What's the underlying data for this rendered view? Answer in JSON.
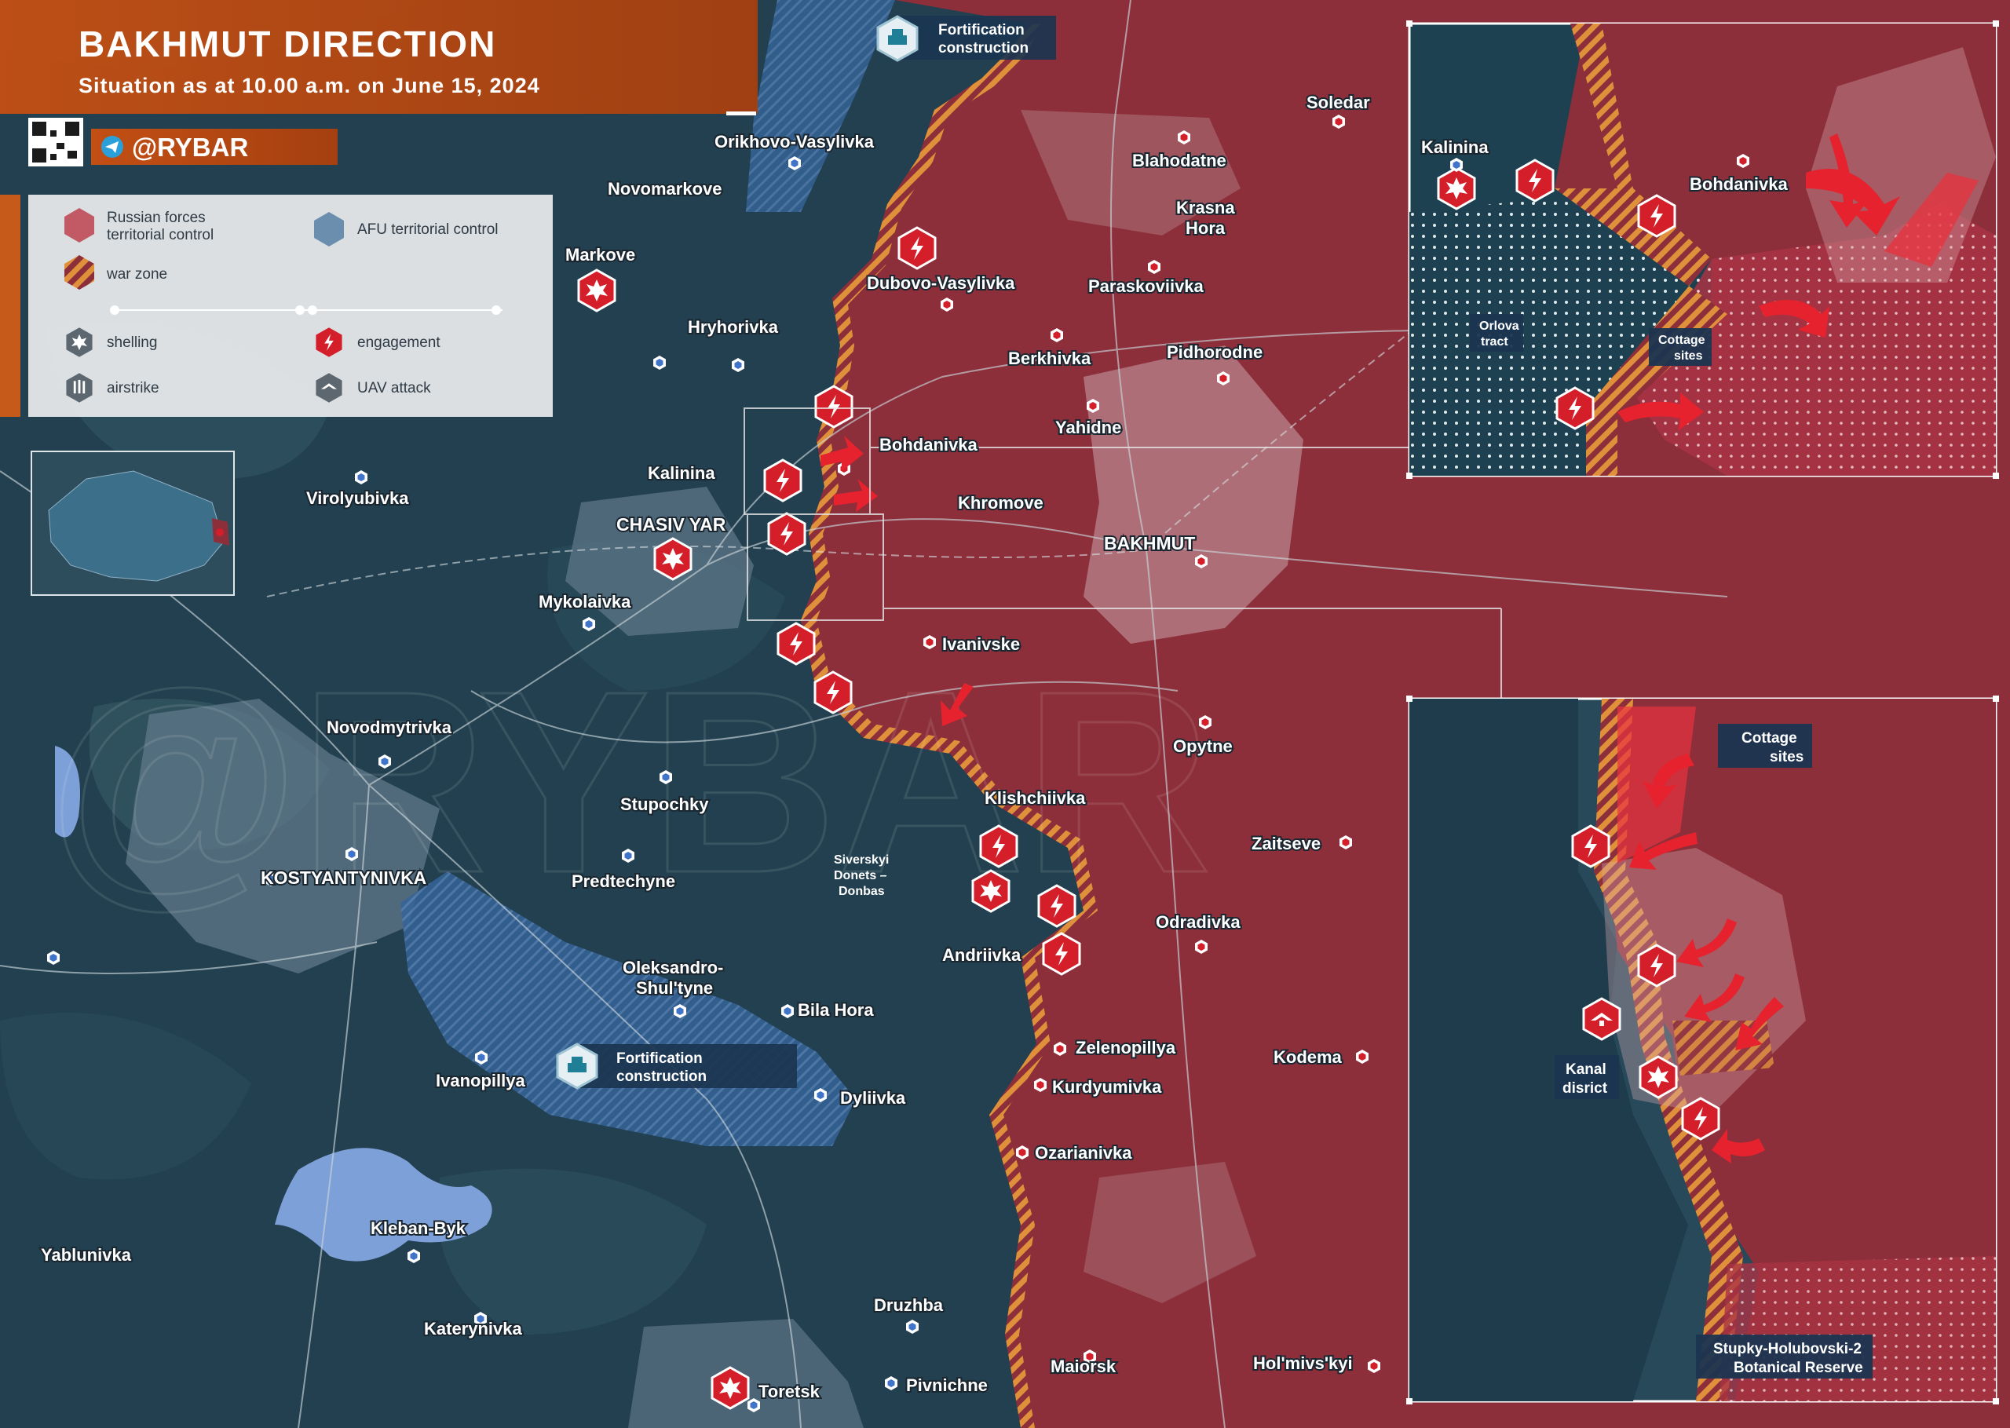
{
  "header": {
    "title": "BAKHMUT DIRECTION",
    "subtitle": "Situation as at 10.00 a.m. on June 15, 2024",
    "brand": "@RYBAR"
  },
  "legend": {
    "russian": "Russian forces territorial control",
    "russian_line1": "Russian forces",
    "russian_line2": "territorial control",
    "afu": "AFU territorial control",
    "war_zone": "war zone",
    "shelling": "shelling",
    "engagement": "engagement",
    "airstrike": "airstrike",
    "uav_attack": "UAV attack"
  },
  "colors": {
    "russian": "#8c2f3a",
    "afu": "#2a4a5f",
    "war_zone": "#e89a3a",
    "engagement": "#d41e2a",
    "header": "#c55a1a"
  },
  "fortifications": [
    {
      "label": "Fortification construction",
      "line1": "Fortification",
      "line2": "construction"
    },
    {
      "label": "Fortification construction",
      "line1": "Fortification",
      "line2": "construction"
    }
  ],
  "towns": {
    "orikhovo": "Orikhovo-Vasylivka",
    "novomarkove": "Novomarkove",
    "markove": "Markove",
    "dubovo": "Dubovo-Vasylivka",
    "hryhorivka": "Hryhorivka",
    "bohdanivka": "Bohdanivka",
    "kalinina": "Kalinina",
    "chasiv_yar": "CHASIV YAR",
    "virolyubivka": "Virolyubivka",
    "mykolaivka": "Mykolaivka",
    "novodmytrivka": "Novodmytrivka",
    "stupochky": "Stupochky",
    "predtechyne": "Predtechyne",
    "kostyantynivka": "KOSTYANTYNIVKA",
    "oleksandro_1": "Oleksandro-",
    "oleksandro_2": "Shul'tyne",
    "bila_hora": "Bila Hora",
    "ivanopillya": "Ivanopillya",
    "dyliivka": "Dyliivka",
    "kleban_byk": "Kleban-Byk",
    "yablunivka": "Yablunivka",
    "katerynivka": "Katerynivka",
    "druzhba": "Druzhba",
    "toretsk": "Toretsk",
    "pivnichne": "Pivnichne",
    "maiorsk": "Maiorsk",
    "holmivskyi": "Hol'mivs'kyi",
    "soledar": "Soledar",
    "blahodatne": "Blahodatne",
    "krasna_1": "Krasna",
    "krasna_2": "Hora",
    "paraskoviivka": "Paraskoviivka",
    "berkhivka": "Berkhivka",
    "pidhorodne": "Pidhorodne",
    "yahidne": "Yahidne",
    "khromove": "Khromove",
    "bakhmut": "BAKHMUT",
    "ivanivske": "Ivanivske",
    "opytne": "Opytne",
    "klishchiivka": "Klishchiivka",
    "zaitseve": "Zaitseve",
    "andriivka": "Andriivka",
    "odradivka": "Odradivka",
    "zelenopillya": "Zelenopillya",
    "kurdyumivka": "Kurdyumivka",
    "kodema": "Kodema",
    "ozarianivka": "Ozarianivka",
    "siversky_1": "Siverskyi",
    "siversky_2": "Donets –",
    "siversky_3": "Donbas"
  },
  "inset_top": {
    "kalinina": "Kalinina",
    "bohdanivka": "Bohdanivka",
    "orlova_1": "Orlova",
    "orlova_2": "tract",
    "cottage_1": "Cottage",
    "cottage_2": "sites"
  },
  "inset_bottom": {
    "cottage_1": "Cottage",
    "cottage_2": "sites",
    "kanal_1": "Kanal",
    "kanal_2": "disrict",
    "reserve_1": "Stupky-Holubovski-2",
    "reserve_2": "Botanical Reserve"
  },
  "watermark": "@RYBAR"
}
